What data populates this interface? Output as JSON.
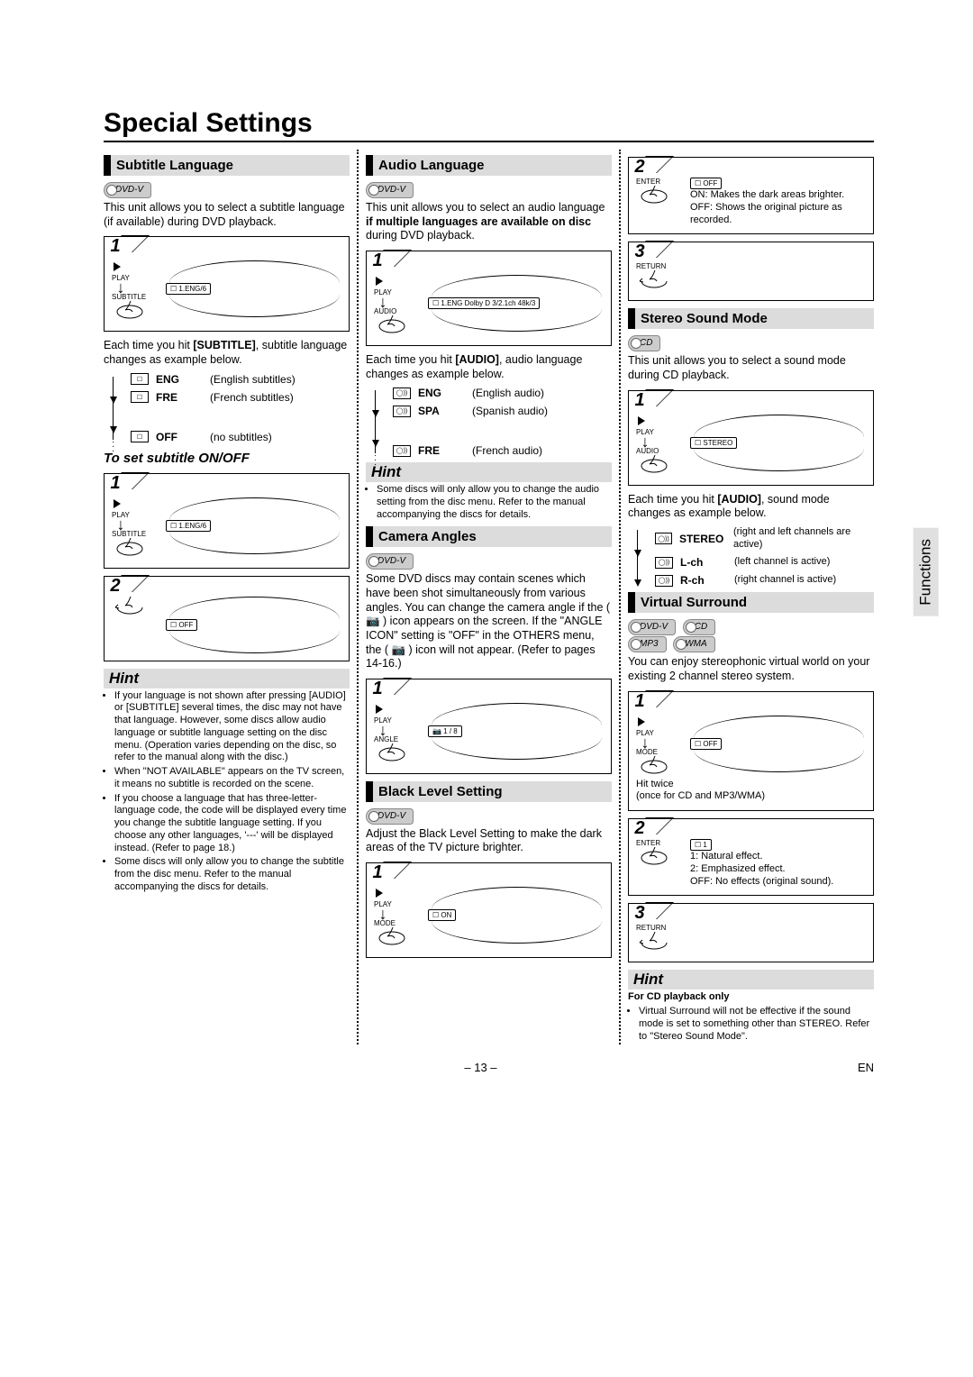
{
  "page_title": "Special Settings",
  "side_tab": "Functions",
  "footer": {
    "page": "– 13 –",
    "lang": "EN"
  },
  "col1": {
    "s1": {
      "head": "Subtitle Language",
      "format": "DVD-V",
      "intro": "This unit allows you to select a subtitle language (if available) during DVD playback.",
      "step1_play": "PLAY",
      "step1_btn": "SUBTITLE",
      "step1_osd": "☐ 1.ENG/6",
      "cycle_pre": "Each time you hit ",
      "cycle_bold": "[SUBTITLE]",
      "cycle_post": ", subtitle language changes as example below.",
      "langs": [
        {
          "code": "ENG",
          "desc": "(English subtitles)"
        },
        {
          "code": "FRE",
          "desc": "(French subtitles)"
        },
        {
          "code": "OFF",
          "desc": "(no subtitles)"
        }
      ],
      "sub_head": "To set subtitle ON/OFF",
      "step1b_play": "PLAY",
      "step1b_btn": "SUBTITLE",
      "step1b_osd": "☐ 1.ENG/6",
      "step2_osd": "☐ OFF"
    },
    "hint": {
      "head": "Hint",
      "items": [
        "If your language is not shown after pressing [AUDIO] or [SUBTITLE] several times, the disc may not have that language. However, some discs allow audio language or subtitle language setting on the disc menu. (Operation varies depending on the disc, so refer to the manual along with the disc.)",
        "When \"NOT AVAILABLE\" appears on the TV screen, it means no subtitle is recorded on the scene.",
        "If you choose a language that has three-letter-language code, the code will be displayed every time you change the subtitle language setting. If you choose any other languages, '---' will be displayed instead. (Refer to page 18.)",
        "Some discs will only allow you to change the subtitle from the disc menu. Refer to the manual accompanying the discs for details."
      ]
    }
  },
  "col2": {
    "s1": {
      "head": "Audio Language",
      "format": "DVD-V",
      "intro_pre": "This unit allows you to select an audio language ",
      "intro_bold": "if multiple languages are available on disc",
      "intro_post": " during DVD playback.",
      "step1_play": "PLAY",
      "step1_btn": "AUDIO",
      "step1_osd": "☐ 1.ENG Dolby D 3/2.1ch 48k/3",
      "cycle_pre": "Each time you hit ",
      "cycle_bold": "[AUDIO]",
      "cycle_post": ", audio language changes as example below.",
      "langs": [
        {
          "code": "ENG",
          "desc": "(English audio)"
        },
        {
          "code": "SPA",
          "desc": "(Spanish audio)"
        },
        {
          "code": "FRE",
          "desc": "(French audio)"
        }
      ]
    },
    "hint": {
      "head": "Hint",
      "items": [
        "Some discs will only allow you to change the audio setting from the disc menu. Refer to the manual accompanying the discs for details."
      ]
    },
    "s2": {
      "head": "Camera Angles",
      "format": "DVD-V",
      "body": "Some DVD discs may contain scenes which have been shot simultaneously from various angles. You can change the camera angle if the ( 📷 ) icon appears on the screen. If the \"ANGLE ICON\" setting is \"OFF\" in the OTHERS menu, the ( 📷 ) icon will not appear. (Refer to pages 14-16.)",
      "step1_play": "PLAY",
      "step1_btn": "ANGLE",
      "step1_osd": "📷 1 / 8"
    },
    "s3": {
      "head": "Black Level Setting",
      "format": "DVD-V",
      "body": "Adjust the Black Level Setting to make the dark areas of the TV picture brighter.",
      "step1_play": "PLAY",
      "step1_btn": "MODE",
      "step1_osd": "☐ ON"
    }
  },
  "col3": {
    "top": {
      "step2_btn": "ENTER",
      "step2_osd": "☐ OFF",
      "note1": "ON: Makes the dark areas brighter.",
      "note2": "OFF: Shows the original picture as recorded.",
      "step3_btn": "RETURN"
    },
    "s1": {
      "head": "Stereo Sound Mode",
      "format": "CD",
      "intro": "This unit allows you to select a sound mode during CD playback.",
      "step1_play": "PLAY",
      "step1_btn": "AUDIO",
      "step1_osd": "☐ STEREO",
      "cycle_pre": "Each time you hit ",
      "cycle_bold": "[AUDIO]",
      "cycle_post": ", sound mode changes as example below.",
      "modes": [
        {
          "code": "STEREO",
          "desc": "(right and left channels are active)"
        },
        {
          "code": "L-ch",
          "desc": "(left channel is active)"
        },
        {
          "code": "R-ch",
          "desc": "(right channel is active)"
        }
      ]
    },
    "s2": {
      "head": "Virtual Surround",
      "formats": [
        "DVD-V",
        "CD",
        "MP3",
        "WMA"
      ],
      "intro": "You can enjoy stereophonic virtual world on your existing 2 channel stereo system.",
      "step1_play": "PLAY",
      "step1_btn": "MODE",
      "step1_osd": "☐ OFF",
      "step1_note1": "Hit twice",
      "step1_note2": "(once for CD and MP3/WMA)",
      "step2_btn": "ENTER",
      "step2_osd": "☐ 1",
      "step2_n1": "1: Natural effect.",
      "step2_n2": "2: Emphasized effect.",
      "step2_n3": "OFF: No effects (original sound).",
      "step3_btn": "RETURN"
    },
    "hint": {
      "head": "Hint",
      "sub": "For CD playback only",
      "items": [
        "Virtual Surround will not be effective if the sound mode is set to something other than STEREO. Refer to \"Stereo Sound Mode\"."
      ]
    }
  }
}
